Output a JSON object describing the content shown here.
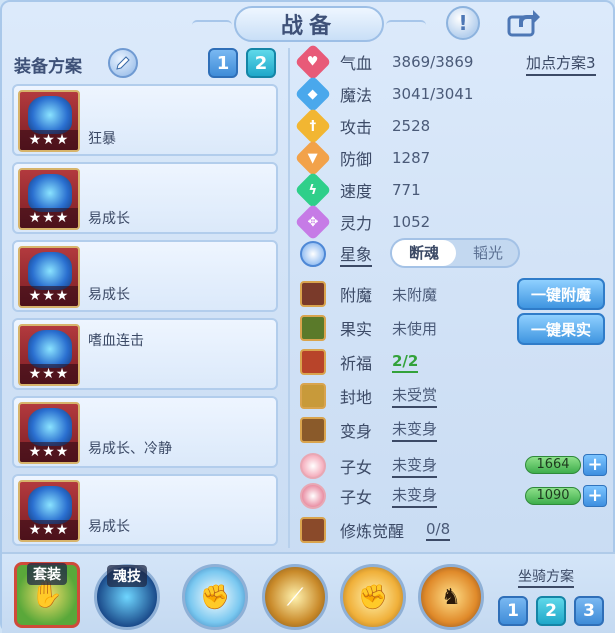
{
  "title": "战备",
  "equip_panel": {
    "label": "装备方案",
    "plans": [
      "1",
      "2"
    ],
    "selected_plan": "2",
    "items": [
      {
        "name": "狂暴",
        "stars": "★★★"
      },
      {
        "name": "易成长",
        "stars": "★★★"
      },
      {
        "name": "易成长",
        "stars": "★★★"
      },
      {
        "name": "嗜血连击",
        "stars": "★★★"
      },
      {
        "name": "易成长、冷静",
        "stars": "★★★"
      },
      {
        "name": "易成长",
        "stars": "★★★"
      }
    ]
  },
  "stats": {
    "hp": {
      "label": "气血",
      "value": "3869/3869",
      "icon": "heart-icon",
      "color": "#e85a78"
    },
    "mp": {
      "label": "魔法",
      "value": "3041/3041",
      "icon": "shield-icon",
      "color": "#4aa8ec"
    },
    "atk": {
      "label": "攻击",
      "value": "2528",
      "icon": "sword-icon",
      "color": "#f2b632"
    },
    "def": {
      "label": "防御",
      "value": "1287",
      "icon": "armor-icon",
      "color": "#f2a24a"
    },
    "spd": {
      "label": "速度",
      "value": "771",
      "icon": "lightning-icon",
      "color": "#2fcf8a"
    },
    "spirit": {
      "label": "灵力",
      "value": "1052",
      "icon": "spirit-icon",
      "color": "#c67be6"
    }
  },
  "addpoint_plan": "加点方案3",
  "star_sign": {
    "label": "星象",
    "options": [
      "断魂",
      "韬光"
    ],
    "selected": "断魂"
  },
  "extras": {
    "enchant": {
      "label": "附魔",
      "value": "未附魔"
    },
    "fruit": {
      "label": "果实",
      "value": "未使用"
    },
    "blessing": {
      "label": "祈福",
      "value": "2/2"
    },
    "fiefdom": {
      "label": "封地",
      "value": "未受赏"
    },
    "transform": {
      "label": "变身",
      "value": "未变身"
    },
    "child1": {
      "label": "子女",
      "value": "未变身",
      "bar": "1664"
    },
    "child2": {
      "label": "子女",
      "value": "未变身",
      "bar": "1090"
    },
    "cultivation": {
      "label": "修炼觉醒",
      "value": "0/8"
    }
  },
  "actions": {
    "one_click_enchant": "一键附魔",
    "one_click_fruit": "一键果实"
  },
  "bottom": {
    "set_label": "套装",
    "soul_skill_label": "魂技",
    "mount_label": "坐骑方案",
    "mount_plans": [
      "1",
      "2",
      "3"
    ],
    "mount_selected": "2"
  },
  "colors": {
    "accent": "#3f8cd8",
    "selected": "#1fa7c9",
    "panel_bg": "#dceafb"
  }
}
